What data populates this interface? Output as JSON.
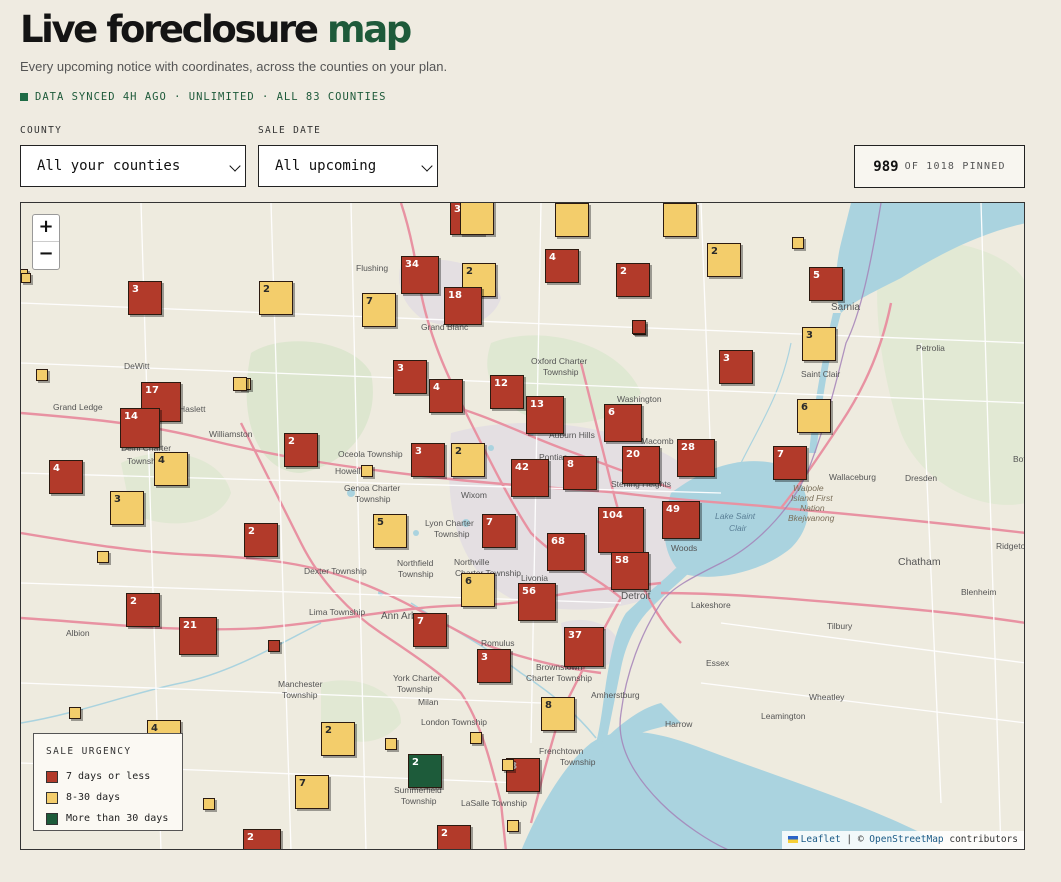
{
  "header": {
    "title_main": "Live foreclosure",
    "title_accent": "map",
    "subtitle": "Every upcoming notice with coordinates, across the counties on your plan.",
    "sync_status": "DATA SYNCED 4H AGO · UNLIMITED · ALL 83 COUNTIES"
  },
  "filters": {
    "county_label": "COUNTY",
    "county_value": "All your counties",
    "sale_date_label": "SALE DATE",
    "sale_date_value": "All upcoming"
  },
  "pinned": {
    "count": "989",
    "suffix": "OF 1018 PINNED"
  },
  "map": {
    "zoom_in": "+",
    "zoom_out": "−",
    "attribution_leaflet": "Leaflet",
    "attribution_sep": " | © ",
    "attribution_osm": "OpenStreetMap",
    "attribution_rest": " contributors",
    "place_labels": [
      "Flushing",
      "Grand Blanc",
      "DeWitt",
      "Grand Ledge",
      "Haslett",
      "Williamston",
      "Oxford Charter Township",
      "Washington Township",
      "Auburn Hills",
      "Macomb",
      "Pontiac",
      "Sterling Heights",
      "Sarnia",
      "Petrolia",
      "Saint Clair",
      "Wallaceburg",
      "Dresden",
      "Walpole Island First Nation",
      "Bkejwanong",
      "Lake Saint Clair",
      "Chatham",
      "Ridgetown",
      "Blenheim",
      "Tilbury",
      "Lakeshore",
      "Windsor",
      "Essex",
      "Amherstburg",
      "Wheatley",
      "Leamington",
      "Harrow",
      "Howell",
      "Genoa Charter Township",
      "Oceola Township",
      "Lyon Charter Township",
      "Northville Charter Township",
      "Novi",
      "Wixom",
      "Livonia",
      "Detroit",
      "Dexter Township",
      "Lima Township",
      "Ann Arbor",
      "Northfield Township",
      "Romulus",
      "Brownstown Charter Township",
      "York Charter Township",
      "Milan",
      "London Township",
      "Manchester Township",
      "Albion",
      "Frenchtown Township",
      "Summerfield Township",
      "LaSalle Township",
      "Woods",
      "Delhi Charter Township",
      "Wooster"
    ],
    "legend": {
      "title": "SALE URGENCY",
      "items": [
        {
          "label": "7 days or less",
          "color": "#b23a2a"
        },
        {
          "label": "8-30 days",
          "color": "#f3cd6b"
        },
        {
          "label": "More than 30 days",
          "color": "#1d5b3a"
        }
      ]
    },
    "markers": [
      {
        "count": "3",
        "urgency": "red"
      },
      {
        "count": "34",
        "urgency": "red"
      },
      {
        "count": "2",
        "urgency": "yellow"
      },
      {
        "count": "4",
        "urgency": "red"
      },
      {
        "count": "2",
        "urgency": "red"
      },
      {
        "count": "2",
        "urgency": "yellow"
      },
      {
        "count": "5",
        "urgency": "red"
      },
      {
        "count": "3",
        "urgency": "red"
      },
      {
        "count": "2",
        "urgency": "yellow"
      },
      {
        "count": "7",
        "urgency": "yellow"
      },
      {
        "count": "18",
        "urgency": "red"
      },
      {
        "count": "3",
        "urgency": "yellow"
      },
      {
        "count": "3",
        "urgency": "red"
      },
      {
        "count": "6",
        "urgency": "yellow"
      },
      {
        "count": "3",
        "urgency": "red"
      },
      {
        "count": "4",
        "urgency": "red"
      },
      {
        "count": "12",
        "urgency": "red"
      },
      {
        "count": "17",
        "urgency": "red"
      },
      {
        "count": "14",
        "urgency": "red"
      },
      {
        "count": "13",
        "urgency": "red"
      },
      {
        "count": "6",
        "urgency": "red"
      },
      {
        "count": "2",
        "urgency": "red"
      },
      {
        "count": "3",
        "urgency": "red"
      },
      {
        "count": "2",
        "urgency": "yellow"
      },
      {
        "count": "42",
        "urgency": "red"
      },
      {
        "count": "8",
        "urgency": "red"
      },
      {
        "count": "20",
        "urgency": "red"
      },
      {
        "count": "28",
        "urgency": "red"
      },
      {
        "count": "7",
        "urgency": "red"
      },
      {
        "count": "4",
        "urgency": "red"
      },
      {
        "count": "4",
        "urgency": "yellow"
      },
      {
        "count": "3",
        "urgency": "yellow"
      },
      {
        "count": "2",
        "urgency": "red"
      },
      {
        "count": "5",
        "urgency": "yellow"
      },
      {
        "count": "7",
        "urgency": "red"
      },
      {
        "count": "104",
        "urgency": "red"
      },
      {
        "count": "49",
        "urgency": "red"
      },
      {
        "count": "68",
        "urgency": "red"
      },
      {
        "count": "58",
        "urgency": "red"
      },
      {
        "count": "6",
        "urgency": "yellow"
      },
      {
        "count": "56",
        "urgency": "red"
      },
      {
        "count": "2",
        "urgency": "red"
      },
      {
        "count": "21",
        "urgency": "red"
      },
      {
        "count": "7",
        "urgency": "red"
      },
      {
        "count": "37",
        "urgency": "red"
      },
      {
        "count": "3",
        "urgency": "red"
      },
      {
        "count": "8",
        "urgency": "yellow"
      },
      {
        "count": "2",
        "urgency": "yellow"
      },
      {
        "count": "4",
        "urgency": "yellow"
      },
      {
        "count": "2",
        "urgency": "green"
      },
      {
        "count": "8",
        "urgency": "red"
      },
      {
        "count": "7",
        "urgency": "yellow"
      },
      {
        "count": "2",
        "urgency": "red"
      },
      {
        "count": "2",
        "urgency": "red"
      },
      {
        "count": "",
        "urgency": "yellow"
      },
      {
        "count": "",
        "urgency": "yellow"
      },
      {
        "count": "",
        "urgency": "yellow"
      },
      {
        "count": "",
        "urgency": "yellow"
      },
      {
        "count": "",
        "urgency": "red"
      },
      {
        "count": "",
        "urgency": "yellow"
      },
      {
        "count": "",
        "urgency": "yellow"
      },
      {
        "count": "",
        "urgency": "yellow"
      },
      {
        "count": "",
        "urgency": "yellow"
      },
      {
        "count": "",
        "urgency": "red"
      },
      {
        "count": "",
        "urgency": "yellow"
      },
      {
        "count": "",
        "urgency": "yellow"
      },
      {
        "count": "",
        "urgency": "yellow"
      },
      {
        "count": "",
        "urgency": "yellow"
      },
      {
        "count": "",
        "urgency": "yellow"
      },
      {
        "count": "",
        "urgency": "yellow"
      },
      {
        "count": "",
        "urgency": "yellow"
      },
      {
        "count": "",
        "urgency": "red"
      },
      {
        "count": "",
        "urgency": "yellow"
      },
      {
        "count": "",
        "urgency": "yellow"
      }
    ]
  }
}
